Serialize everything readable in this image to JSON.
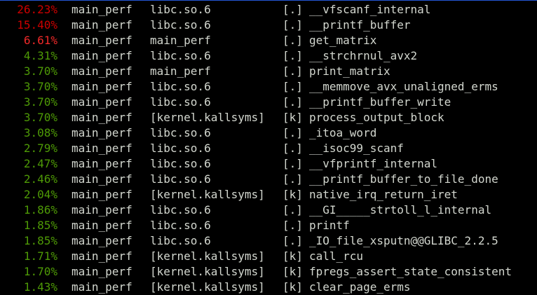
{
  "colors": {
    "background": "#000000",
    "text": "#d3d7cf",
    "overhead_high": "#cc0000",
    "overhead_medium": "#ef2929",
    "overhead_low": "#4e9a06",
    "selection_bar": "#2456d6"
  },
  "report": {
    "rows": [
      {
        "overhead": "26.23%",
        "level": "high",
        "command": "main_perf",
        "shared_object": "libc.so.6",
        "privilege": "[.]",
        "symbol": "__vfscanf_internal"
      },
      {
        "overhead": "15.40%",
        "level": "high",
        "command": "main_perf",
        "shared_object": "libc.so.6",
        "privilege": "[.]",
        "symbol": "__printf_buffer"
      },
      {
        "overhead": "6.61%",
        "level": "medium",
        "command": "main_perf",
        "shared_object": "main_perf",
        "privilege": "[.]",
        "symbol": "get_matrix"
      },
      {
        "overhead": "4.31%",
        "level": "low",
        "command": "main_perf",
        "shared_object": "libc.so.6",
        "privilege": "[.]",
        "symbol": "__strchrnul_avx2"
      },
      {
        "overhead": "3.70%",
        "level": "low",
        "command": "main_perf",
        "shared_object": "main_perf",
        "privilege": "[.]",
        "symbol": "print_matrix"
      },
      {
        "overhead": "3.70%",
        "level": "low",
        "command": "main_perf",
        "shared_object": "libc.so.6",
        "privilege": "[.]",
        "symbol": "__memmove_avx_unaligned_erms"
      },
      {
        "overhead": "3.70%",
        "level": "low",
        "command": "main_perf",
        "shared_object": "libc.so.6",
        "privilege": "[.]",
        "symbol": "__printf_buffer_write"
      },
      {
        "overhead": "3.70%",
        "level": "low",
        "command": "main_perf",
        "shared_object": "[kernel.kallsyms]",
        "privilege": "[k]",
        "symbol": "process_output_block"
      },
      {
        "overhead": "3.08%",
        "level": "low",
        "command": "main_perf",
        "shared_object": "libc.so.6",
        "privilege": "[.]",
        "symbol": "_itoa_word"
      },
      {
        "overhead": "2.79%",
        "level": "low",
        "command": "main_perf",
        "shared_object": "libc.so.6",
        "privilege": "[.]",
        "symbol": "__isoc99_scanf"
      },
      {
        "overhead": "2.47%",
        "level": "low",
        "command": "main_perf",
        "shared_object": "libc.so.6",
        "privilege": "[.]",
        "symbol": "__vfprintf_internal"
      },
      {
        "overhead": "2.46%",
        "level": "low",
        "command": "main_perf",
        "shared_object": "libc.so.6",
        "privilege": "[.]",
        "symbol": "__printf_buffer_to_file_done"
      },
      {
        "overhead": "2.04%",
        "level": "low",
        "command": "main_perf",
        "shared_object": "[kernel.kallsyms]",
        "privilege": "[k]",
        "symbol": "native_irq_return_iret"
      },
      {
        "overhead": "1.86%",
        "level": "low",
        "command": "main_perf",
        "shared_object": "libc.so.6",
        "privilege": "[.]",
        "symbol": "__GI_____strtoll_l_internal"
      },
      {
        "overhead": "1.85%",
        "level": "low",
        "command": "main_perf",
        "shared_object": "libc.so.6",
        "privilege": "[.]",
        "symbol": "printf"
      },
      {
        "overhead": "1.85%",
        "level": "low",
        "command": "main_perf",
        "shared_object": "libc.so.6",
        "privilege": "[.]",
        "symbol": "_IO_file_xsputn@@GLIBC_2.2.5"
      },
      {
        "overhead": "1.71%",
        "level": "low",
        "command": "main_perf",
        "shared_object": "[kernel.kallsyms]",
        "privilege": "[k]",
        "symbol": "call_rcu"
      },
      {
        "overhead": "1.70%",
        "level": "low",
        "command": "main_perf",
        "shared_object": "[kernel.kallsyms]",
        "privilege": "[k]",
        "symbol": "fpregs_assert_state_consistent"
      },
      {
        "overhead": "1.43%",
        "level": "low",
        "command": "main_perf",
        "shared_object": "[kernel.kallsyms]",
        "privilege": "[k]",
        "symbol": "clear_page_erms"
      }
    ]
  }
}
